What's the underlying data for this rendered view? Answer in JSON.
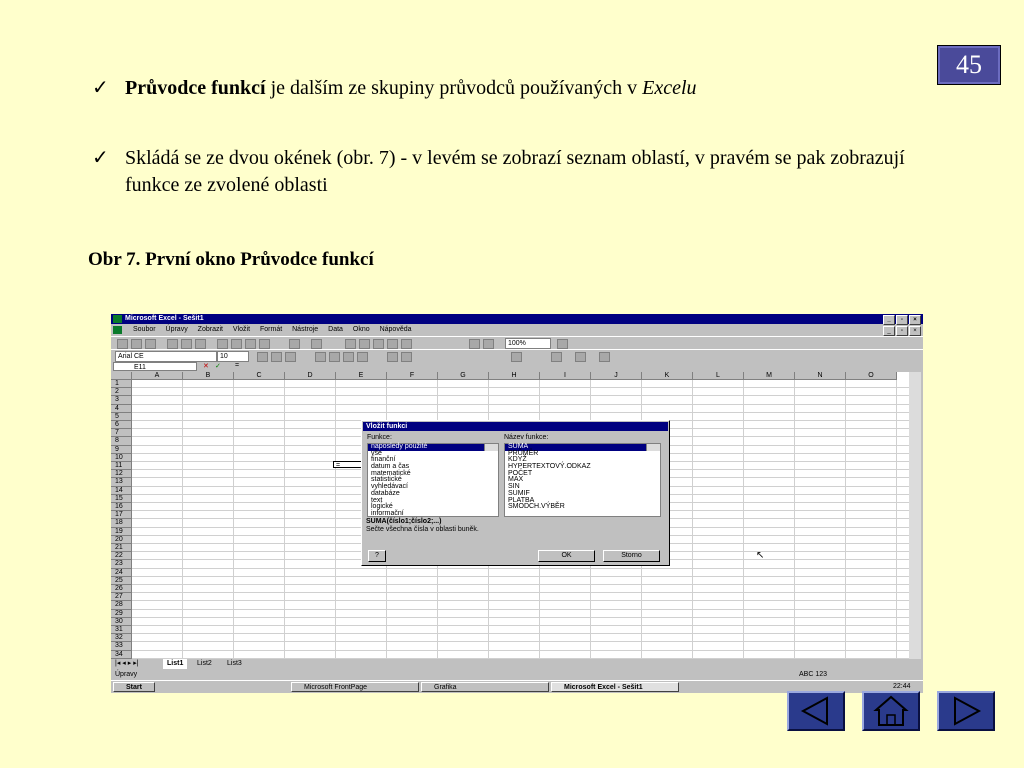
{
  "slide_number": "45",
  "bullets": [
    {
      "mark": "✓",
      "bold": "Průvodce funkcí",
      "text": " je dalším ze skupiny průvodců používaných v ",
      "italic": "Excelu"
    },
    {
      "mark": "✓",
      "text": "Skládá se ze dvou okének (obr. 7) - v levém se zobrazí seznam oblastí, v pravém se pak zobrazují funkce ze zvolené oblasti"
    }
  ],
  "caption": "Obr 7.  První okno Průvodce funkcí",
  "excel": {
    "title": "Microsoft Excel - Sešit1",
    "menu": [
      "Soubor",
      "Úpravy",
      "Zobrazit",
      "Vložit",
      "Formát",
      "Nástroje",
      "Data",
      "Okno",
      "Nápověda"
    ],
    "zoom": "100%",
    "font": "Arial CE",
    "font_size": "10",
    "name_box": "E11",
    "formula": "=",
    "cell_value": "=",
    "columns": [
      "A",
      "B",
      "C",
      "D",
      "E",
      "F",
      "G",
      "H",
      "I",
      "J",
      "K",
      "L",
      "M",
      "N",
      "O"
    ],
    "rows": [
      "1",
      "2",
      "3",
      "4",
      "5",
      "6",
      "7",
      "8",
      "9",
      "10",
      "11",
      "12",
      "13",
      "14",
      "15",
      "16",
      "17",
      "18",
      "19",
      "20",
      "21",
      "22",
      "23",
      "24",
      "25",
      "26",
      "27",
      "28",
      "29",
      "30",
      "31",
      "32",
      "33",
      "34"
    ],
    "sheets": [
      "List1",
      "List2",
      "List3"
    ],
    "status": "Úpravy",
    "status_right": "ABC 123",
    "dialog": {
      "title": "Vložit funkci",
      "left_label": "Funkce:",
      "right_label": "Název funkce:",
      "categories": [
        "naposledy použité",
        "vše",
        "finanční",
        "datum a čas",
        "matematické",
        "statistické",
        "vyhledávací",
        "databáze",
        "text",
        "logické",
        "informační"
      ],
      "functions": [
        "SUMA",
        "PRŮMĚR",
        "KDYŽ",
        "HYPERTEXTOVÝ.ODKAZ",
        "POČET",
        "MAX",
        "SIN",
        "SUMIF",
        "PLATBA",
        "SMODCH.VÝBĚR"
      ],
      "syntax": "SUMA(číslo1;číslo2;...)",
      "description": "Sečte všechna čísla v oblasti buněk.",
      "ok": "OK",
      "cancel": "Storno"
    },
    "taskbar": {
      "start": "Start",
      "tasks": [
        "Microsoft FrontPage",
        "Grafika",
        "Microsoft Excel - Sešit1"
      ],
      "clock": "22:44"
    }
  },
  "nav": {
    "prev_icon": "triangle-left-icon",
    "home_icon": "house-icon",
    "next_icon": "triangle-right-icon"
  }
}
